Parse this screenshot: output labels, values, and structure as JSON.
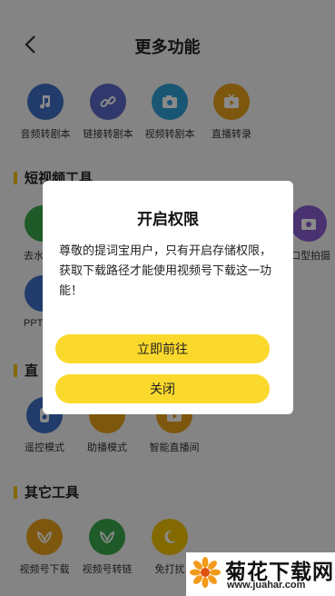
{
  "header": {
    "title": "更多功能"
  },
  "top_tools": [
    {
      "label": "音频转剧本",
      "icon": "music-note-icon",
      "color": "#3e6fc4"
    },
    {
      "label": "链接转剧本",
      "icon": "link-icon",
      "color": "#5b68c9"
    },
    {
      "label": "视频转剧本",
      "icon": "camera-icon",
      "color": "#2fa0d6"
    },
    {
      "label": "直播转录",
      "icon": "tv-play-icon",
      "color": "#e7a21a"
    }
  ],
  "short_video": {
    "title": "短视频工具",
    "visible_labels": [
      "去水",
      "口型拍摄",
      "PPT"
    ]
  },
  "live": {
    "title": "直",
    "tools": [
      {
        "label": "遥控模式",
        "icon": "remote-icon",
        "color": "#3e6fc4"
      },
      {
        "label": "助播模式",
        "icon": "assist-icon",
        "color": "#e7a21a"
      },
      {
        "label": "智能直播间",
        "icon": "tv-play-icon",
        "color": "#e7a21a"
      }
    ]
  },
  "other": {
    "title": "其它工具",
    "tools": [
      {
        "label": "视频号下载",
        "icon": "butterfly-icon",
        "color": "#e7a21a"
      },
      {
        "label": "视频号转链",
        "icon": "butterfly-icon",
        "color": "#3aa84d"
      },
      {
        "label": "免打扰",
        "icon": "moon-icon",
        "color": "#f2c400"
      }
    ]
  },
  "modal": {
    "title": "开启权限",
    "message": "尊敬的提词宝用户，只有开启存储权限，获取下载路径才能使用视频号下载这一功能！",
    "confirm_label": "立即前往",
    "close_label": "关闭",
    "button_color": "#fbd92c"
  },
  "watermark": {
    "name": "菊花下载网",
    "url": "www.juahar.com"
  }
}
